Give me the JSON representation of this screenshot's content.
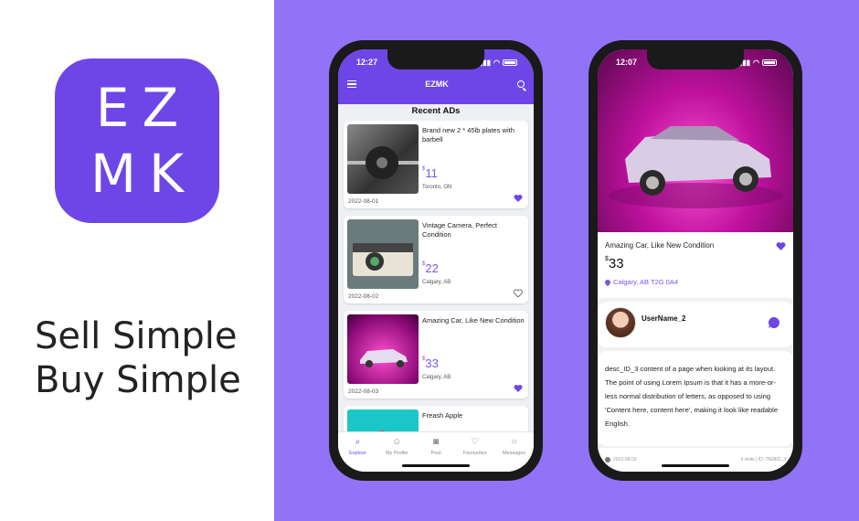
{
  "branding": {
    "icon_line1": "EZ",
    "icon_line2": "MK",
    "tagline_line1": "Sell Simple",
    "tagline_line2": "Buy Simple",
    "accent_color": "#6e46e8",
    "background_color": "#9272f7"
  },
  "phone1": {
    "status_time": "12:27",
    "nav_title": "EZMK",
    "section_title": "Recent ADs",
    "listings": [
      {
        "title": "Brand new 2 * 45lb plates with barbell",
        "price": "11",
        "location": "Toronto, ON",
        "date": "2022-08-01",
        "favorited": true
      },
      {
        "title": "Vintage Camera, Perfect Condition",
        "price": "22",
        "location": "Calgary, AB",
        "date": "2022-08-02",
        "favorited": false
      },
      {
        "title": "Amazing Car, Like New Condition",
        "price": "33",
        "location": "Calgary, AB",
        "date": "2022-08-03",
        "favorited": true
      },
      {
        "title": "Freash Apple",
        "price": "",
        "location": "",
        "date": "",
        "favorited": false
      }
    ],
    "tabs": [
      {
        "label": "Explore",
        "icon": "search-icon",
        "active": true
      },
      {
        "label": "My Profile",
        "icon": "user-icon",
        "active": false
      },
      {
        "label": "Post",
        "icon": "camera-icon",
        "active": false
      },
      {
        "label": "Favourites",
        "icon": "heart-icon",
        "active": false
      },
      {
        "label": "Messages",
        "icon": "chat-icon",
        "active": false
      }
    ]
  },
  "phone2": {
    "status_time": "12:07",
    "title": "Amazing Car, Like New Condition",
    "price": "33",
    "location": "Calgary, AB  T2G 0A4",
    "username": "UserName_2",
    "description": "desc_ID_3 content of a page when looking at its layout. The point of using Lorem Ipsum is that it has a more-or-less normal distribution of letters, as opposed to using 'Content here, content here', making it look like readable English.",
    "post_date": "2022-08-03",
    "meta_right": "4 visits | ID: ITEMID_3"
  }
}
